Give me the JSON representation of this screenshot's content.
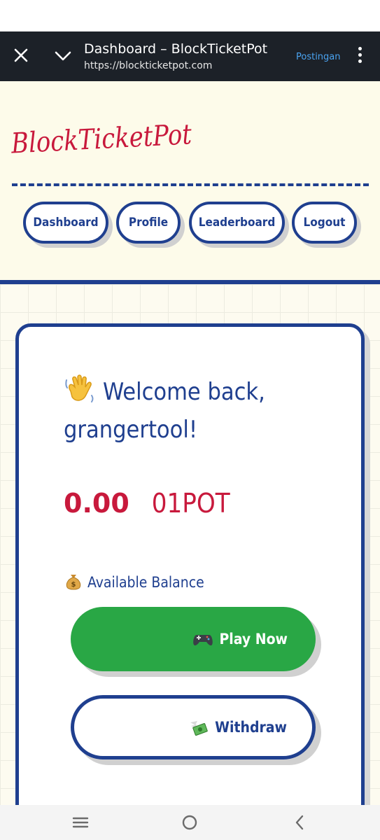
{
  "browser": {
    "title": "Dashboard – BlockTicketPot",
    "url": "https://blockticketpot.com",
    "action_label": "Postingan"
  },
  "header": {
    "logo_text": "BlockTicketPot",
    "nav": [
      "Dashboard",
      "Profile",
      "Leaderboard",
      "Logout"
    ]
  },
  "card": {
    "welcome": "Welcome back, grangertool!",
    "balance_value": "0.00",
    "balance_unit": "01POT",
    "available_label": "Available Balance",
    "play_label": "Play Now",
    "withdraw_label": "Withdraw"
  },
  "icons": {
    "wave": "waving-hand-icon",
    "bag": "money-bag-icon",
    "play": "game-controller-icon",
    "withdraw": "money-with-wings-icon"
  },
  "colors": {
    "primary": "#1f3f8f",
    "accent_red": "#c8193c",
    "play_green": "#29a745",
    "header_bg": "#fdfbea",
    "browser_bar": "#1c2128"
  }
}
